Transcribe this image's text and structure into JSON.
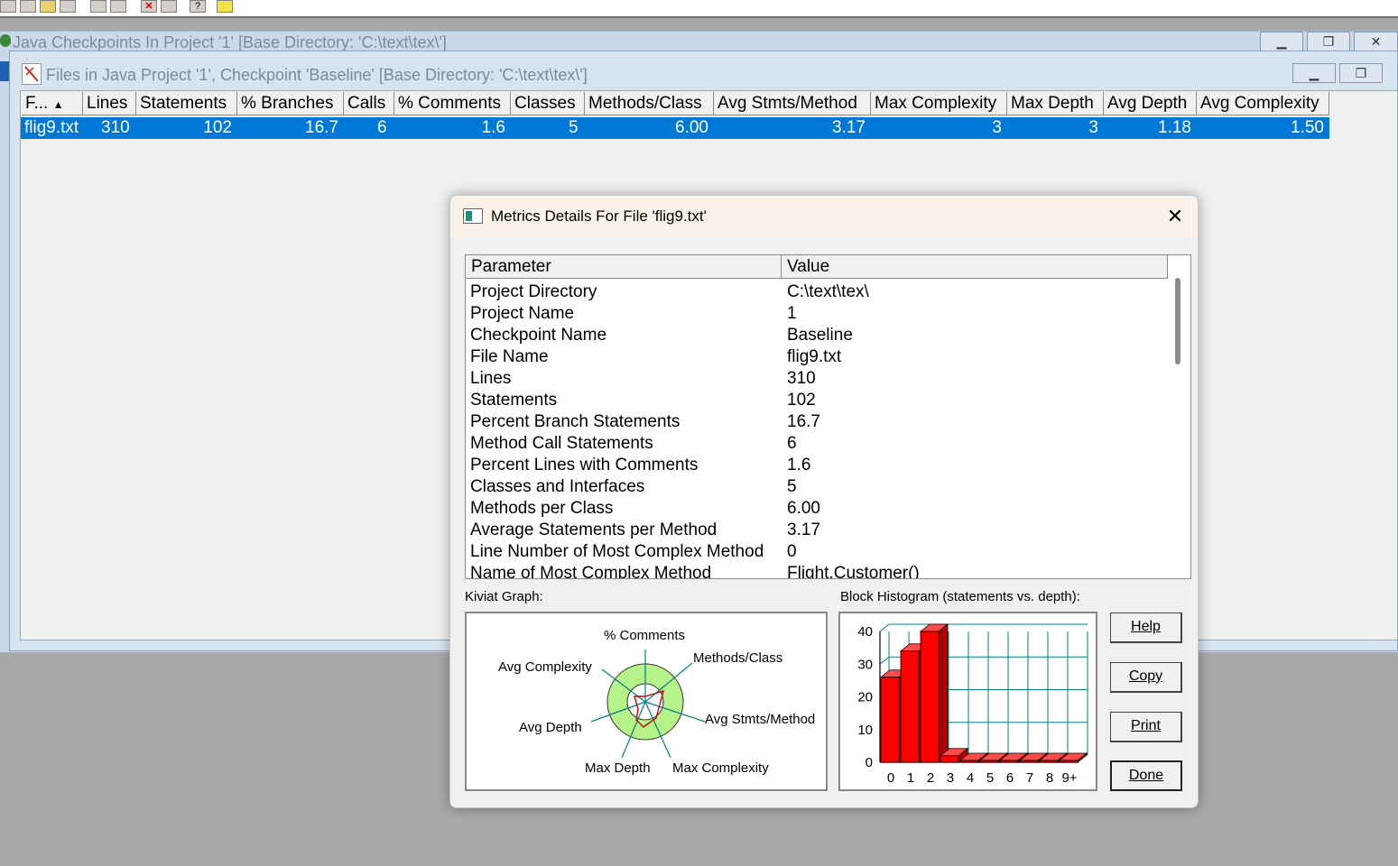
{
  "outer_window": {
    "title": "Java Checkpoints In Project '1'  [Base Directory: 'C:\\text\\tex\\']"
  },
  "inner_window": {
    "title": "Files in Java Project '1', Checkpoint 'Baseline'  [Base Directory: 'C:\\text\\tex\\']",
    "columns": [
      "F...",
      "Lines",
      "Statements",
      "% Branches",
      "Calls",
      "% Comments",
      "Classes",
      "Methods/Class",
      "Avg Stmts/Method",
      "Max Complexity",
      "Max Depth",
      "Avg Depth",
      "Avg Complexity"
    ],
    "row": [
      "flig9.txt",
      "310",
      "102",
      "16.7",
      "6",
      "1.6",
      "5",
      "6.00",
      "3.17",
      "3",
      "3",
      "1.18",
      "1.50"
    ]
  },
  "dialog": {
    "title": "Metrics Details For File 'flig9.txt'",
    "grid_headers": [
      "Parameter",
      "Value"
    ],
    "rows": [
      [
        "Project Directory",
        "C:\\text\\tex\\"
      ],
      [
        "Project Name",
        "1"
      ],
      [
        "Checkpoint Name",
        "Baseline"
      ],
      [
        "File Name",
        "flig9.txt"
      ],
      [
        "Lines",
        "310"
      ],
      [
        "Statements",
        "102"
      ],
      [
        "Percent Branch Statements",
        "16.7"
      ],
      [
        "Method Call Statements",
        "6"
      ],
      [
        "Percent Lines with Comments",
        "1.6"
      ],
      [
        "Classes and Interfaces",
        "5"
      ],
      [
        "Methods per Class",
        "6.00"
      ],
      [
        "Average Statements per Method",
        "3.17"
      ],
      [
        "Line Number of Most Complex Method",
        "0"
      ],
      [
        "Name of Most Complex Method",
        "Flight.Customer()"
      ]
    ],
    "kiviat_label": "Kiviat Graph:",
    "kiviat_axes": [
      "% Comments",
      "Methods/Class",
      "Avg Stmts/Method",
      "Max Complexity",
      "Max Depth",
      "Avg Depth",
      "Avg Complexity"
    ],
    "histogram_label": "Block Histogram (statements vs. depth):",
    "histogram": {
      "categories": [
        "0",
        "1",
        "2",
        "3",
        "4",
        "5",
        "6",
        "7",
        "8",
        "9+"
      ],
      "values": [
        26,
        34,
        40,
        2,
        0,
        0,
        0,
        0,
        0,
        0
      ],
      "yticks": [
        "40",
        "30",
        "20",
        "10",
        "0"
      ],
      "ylim": [
        0,
        40
      ]
    },
    "buttons": {
      "help": "Help",
      "copy": "Copy",
      "print": "Print",
      "done": "Done"
    },
    "close_glyph": "✕"
  },
  "colors": {
    "selection": "#0078d7",
    "bar": "#ff0000",
    "kiviat_fill": "#b6f28a",
    "grid_teal": "#008080"
  }
}
